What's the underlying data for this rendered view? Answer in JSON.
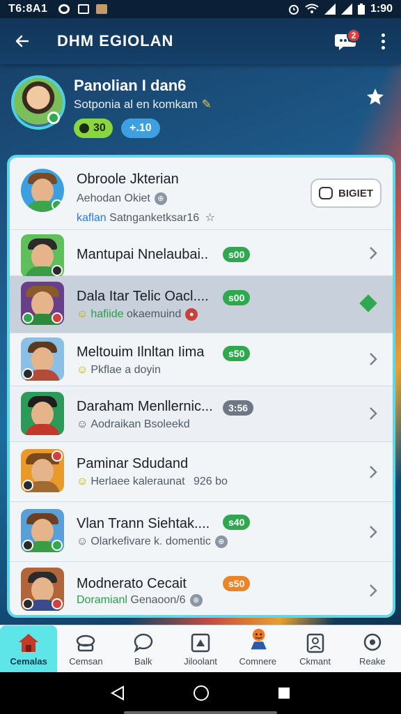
{
  "status_bar": {
    "time": "T6:8A1",
    "clock": "1:90"
  },
  "toolbar": {
    "title": "DHM EGIOLAN",
    "chat_badge": "2"
  },
  "profile": {
    "name": "Panolian I dan6",
    "subtitle": "Sotponia al en komkam",
    "points": "30",
    "bonus": "+.10"
  },
  "header_row": {
    "name": "Obroole Jkterian",
    "sub": "Aehodan Okiet",
    "meta_green": "kaflan",
    "meta": "Satnganketksar16",
    "button_label": "BIGIET"
  },
  "rows": [
    {
      "name": "Mantupai Nnelaubai..",
      "sub": "",
      "badge": "s00",
      "badge_color": "green",
      "state": "normal"
    },
    {
      "name": "Dala Itar Telic Oacl....",
      "sub_hl": "hafiide",
      "sub": "okaemuind",
      "badge": "s00",
      "badge_color": "green",
      "state": "selected"
    },
    {
      "name": "Meltouim Ilnltan Iima",
      "sub": "Pkflae a doyin",
      "badge": "s50",
      "badge_color": "green",
      "state": "normal"
    },
    {
      "name": "Daraham Menllernic...",
      "sub": "Aodraikan Bsoleekd",
      "badge": "3:56",
      "badge_color": "gray",
      "state": "normal"
    },
    {
      "name": "Paminar Sdudand",
      "sub": "Herlaee kaleraunat",
      "sub_extra": "926 bo",
      "badge": "",
      "badge_color": "",
      "state": "normal"
    },
    {
      "name": "Vlan Trann Siehtak....",
      "sub": "Olarkefivare k. domentic",
      "badge": "s40",
      "badge_color": "green",
      "state": "normal"
    },
    {
      "name": "Modnerato Cecait",
      "sub_hl": "Doramianl",
      "sub": "Genaoon/6",
      "badge": "s50",
      "badge_color": "orange",
      "state": "normal"
    }
  ],
  "bottom_nav": [
    {
      "label": "Cemalas",
      "icon": "home-icon",
      "active": true
    },
    {
      "label": "Cemsan",
      "icon": "tray-icon",
      "active": false
    },
    {
      "label": "Balk",
      "icon": "chat-icon",
      "active": false
    },
    {
      "label": "Jiloolant",
      "icon": "puzzle-icon",
      "active": false
    },
    {
      "label": "Comnere",
      "icon": "avatar-icon",
      "active": false
    },
    {
      "label": "Ckmant",
      "icon": "profile-card-icon",
      "active": false
    },
    {
      "label": "Reake",
      "icon": "speech-icon",
      "active": false
    }
  ],
  "colors": {
    "accent": "#60d6e6",
    "active_nav": "#5ee5e8",
    "badge_green": "#2fa84f",
    "badge_orange": "#e8842a",
    "badge_gray": "#6d7884"
  }
}
